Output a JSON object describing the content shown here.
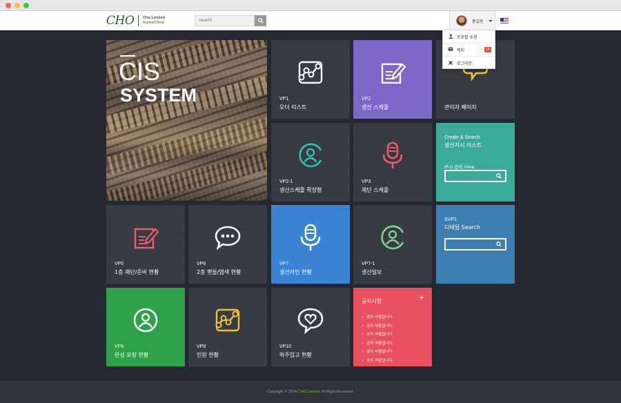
{
  "header": {
    "logo_mark": "CHO",
    "logo_name": "Cho Limited",
    "logo_sub": "Korea/China",
    "search_placeholder": "Search",
    "user_name": "홍길동"
  },
  "user_menu": {
    "items": [
      {
        "label": "프로필 수정",
        "icon": "user-icon"
      },
      {
        "label": "쪽지",
        "icon": "envelope-icon",
        "badge": "15"
      },
      {
        "label": "로그아웃",
        "icon": "close-icon"
      }
    ]
  },
  "hero": {
    "line1": "CIS",
    "line2": "SYSTEM"
  },
  "tiles": {
    "vp1": {
      "code": "VP1",
      "title": "오더 리스트"
    },
    "vp2": {
      "code": "VP2",
      "title": "생산 스케줄"
    },
    "admin": {
      "code": "",
      "title": "관리자 페이지"
    },
    "vp2_1": {
      "code": "VP2-1",
      "title": "생산스케줄 확장형"
    },
    "vp3": {
      "code": "VP3",
      "title": "재단 스케줄"
    },
    "vp5": {
      "code": "VP5",
      "title": "1층 재단/준비 현황"
    },
    "vp6": {
      "code": "VP6",
      "title": "2층 핸들/염색 현황"
    },
    "vp7": {
      "code": "VP7",
      "title": "생산라인 현황"
    },
    "vp7_1": {
      "code": "VP7-1",
      "title": "생산일보"
    },
    "vp8": {
      "code": "VP8",
      "title": "완성 포장 현황"
    },
    "vp9": {
      "code": "VP9",
      "title": "인원 현황"
    },
    "vp10": {
      "code": "VP10",
      "title": "외주입고 현황"
    }
  },
  "create_search": {
    "label1": "Create & Search",
    "label2": "생산지시 리스트",
    "label3": "IP-0 검색 View"
  },
  "svp1": {
    "code": "SVP1",
    "title": "디테일 Search"
  },
  "notice": {
    "title": "공지사항",
    "plus": "+",
    "items": [
      "공지 사항입니다.",
      "공지 사항입니다.",
      "공지 사항입니다.",
      "공지 사항입니다.",
      "공지 사항입니다.",
      "공지 사항입니다."
    ]
  },
  "footer": {
    "prefix": "Copyright © 2014 ",
    "brand": "CHO Limited",
    "suffix": ". All Right Reserved."
  },
  "colors": {
    "purple": "#7b68c8",
    "teal": "#3aaa9a",
    "blue_gray": "#3d7fb0",
    "blue": "#3a84d3",
    "green": "#2ea14a",
    "red": "#e8505f",
    "dark_tile": "#363a42",
    "icon_teal": "#2fc0a8",
    "icon_red": "#f25a6a",
    "icon_green": "#7ed28a",
    "icon_yellow": "#f2c430"
  }
}
